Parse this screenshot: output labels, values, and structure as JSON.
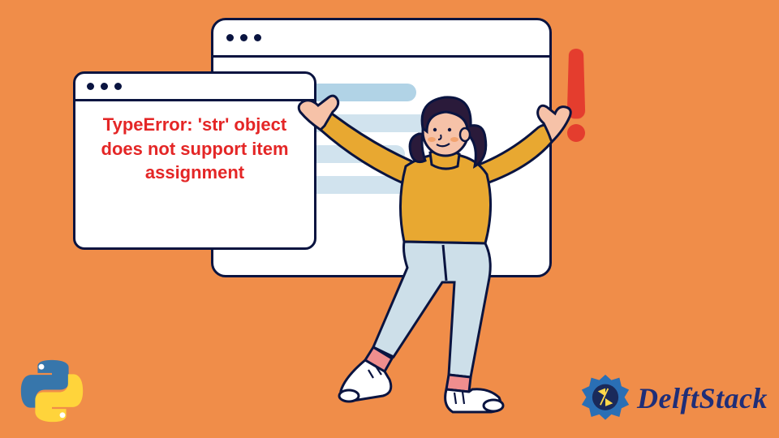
{
  "error_text": "TypeError: 'str' object does not support item assignment",
  "brand": {
    "name": "DelftStack"
  },
  "icons": {
    "python": "python-logo",
    "brand_badge": "delftstack-badge",
    "exclamation": "exclamation-mark"
  },
  "colors": {
    "background": "#f08d49",
    "stroke": "#0a1440",
    "error_red": "#e42626",
    "exclaim_red": "#e43d2e",
    "brand_blue": "#1f2e78",
    "sweater": "#e8a831",
    "pants": "#cddfe9",
    "skin": "#f6c2a8",
    "hair": "#2a1a3a"
  }
}
